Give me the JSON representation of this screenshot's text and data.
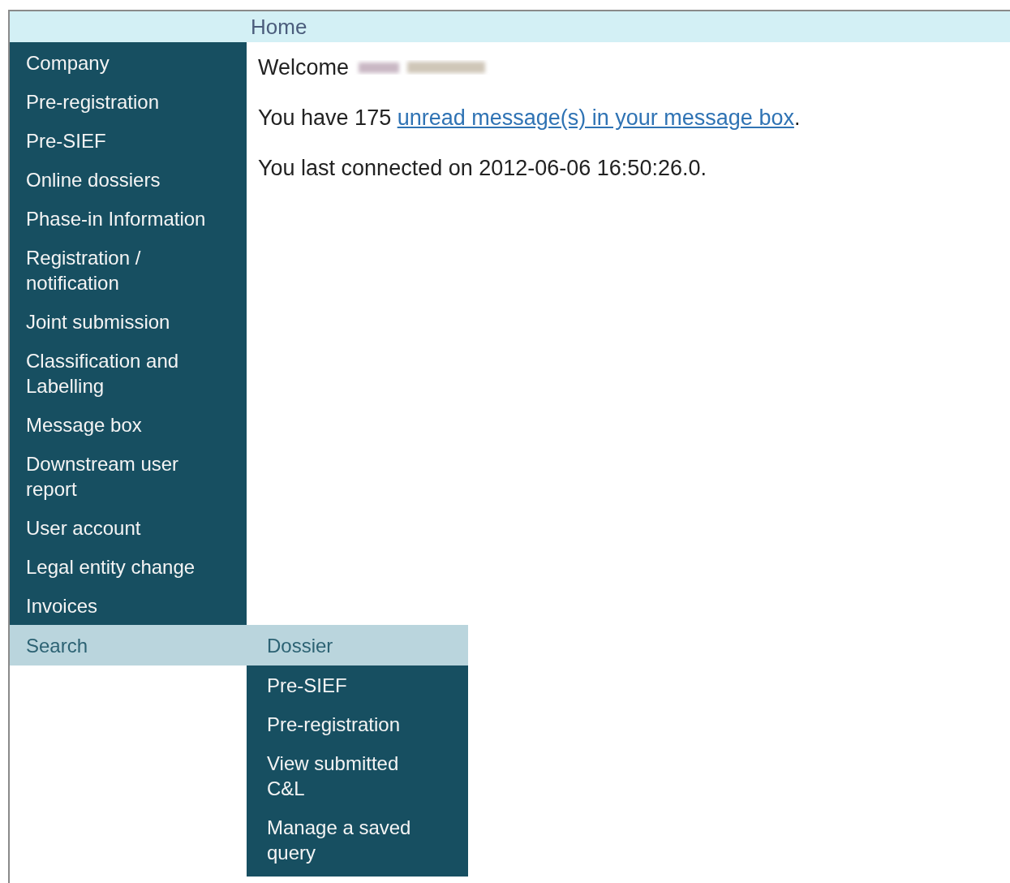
{
  "header": {
    "title": "Home"
  },
  "sidebar": {
    "items": [
      {
        "label": "Company",
        "selected": false
      },
      {
        "label": "Pre-registration",
        "selected": false
      },
      {
        "label": "Pre-SIEF",
        "selected": false
      },
      {
        "label": "Online dossiers",
        "selected": false
      },
      {
        "label": "Phase-in Information",
        "selected": false
      },
      {
        "label": "Registration / notification",
        "selected": false
      },
      {
        "label": "Joint submission",
        "selected": false
      },
      {
        "label": "Classification and Labelling",
        "selected": false
      },
      {
        "label": "Message box",
        "selected": false
      },
      {
        "label": "Downstream user report",
        "selected": false
      },
      {
        "label": "User account",
        "selected": false
      },
      {
        "label": "Legal entity change",
        "selected": false
      },
      {
        "label": "Invoices",
        "selected": false
      },
      {
        "label": "Search",
        "selected": true
      }
    ]
  },
  "flyout": {
    "title": "Dossier",
    "items": [
      "Pre-SIEF",
      "Pre-registration",
      "View submitted C&L",
      "Manage a saved query"
    ]
  },
  "main": {
    "welcome": "Welcome",
    "messages": {
      "before": "You have 175 ",
      "link": "unread message(s) in your message box",
      "after": "."
    },
    "last_connected": "You last connected on 2012-06-06 16:50:26.0."
  }
}
